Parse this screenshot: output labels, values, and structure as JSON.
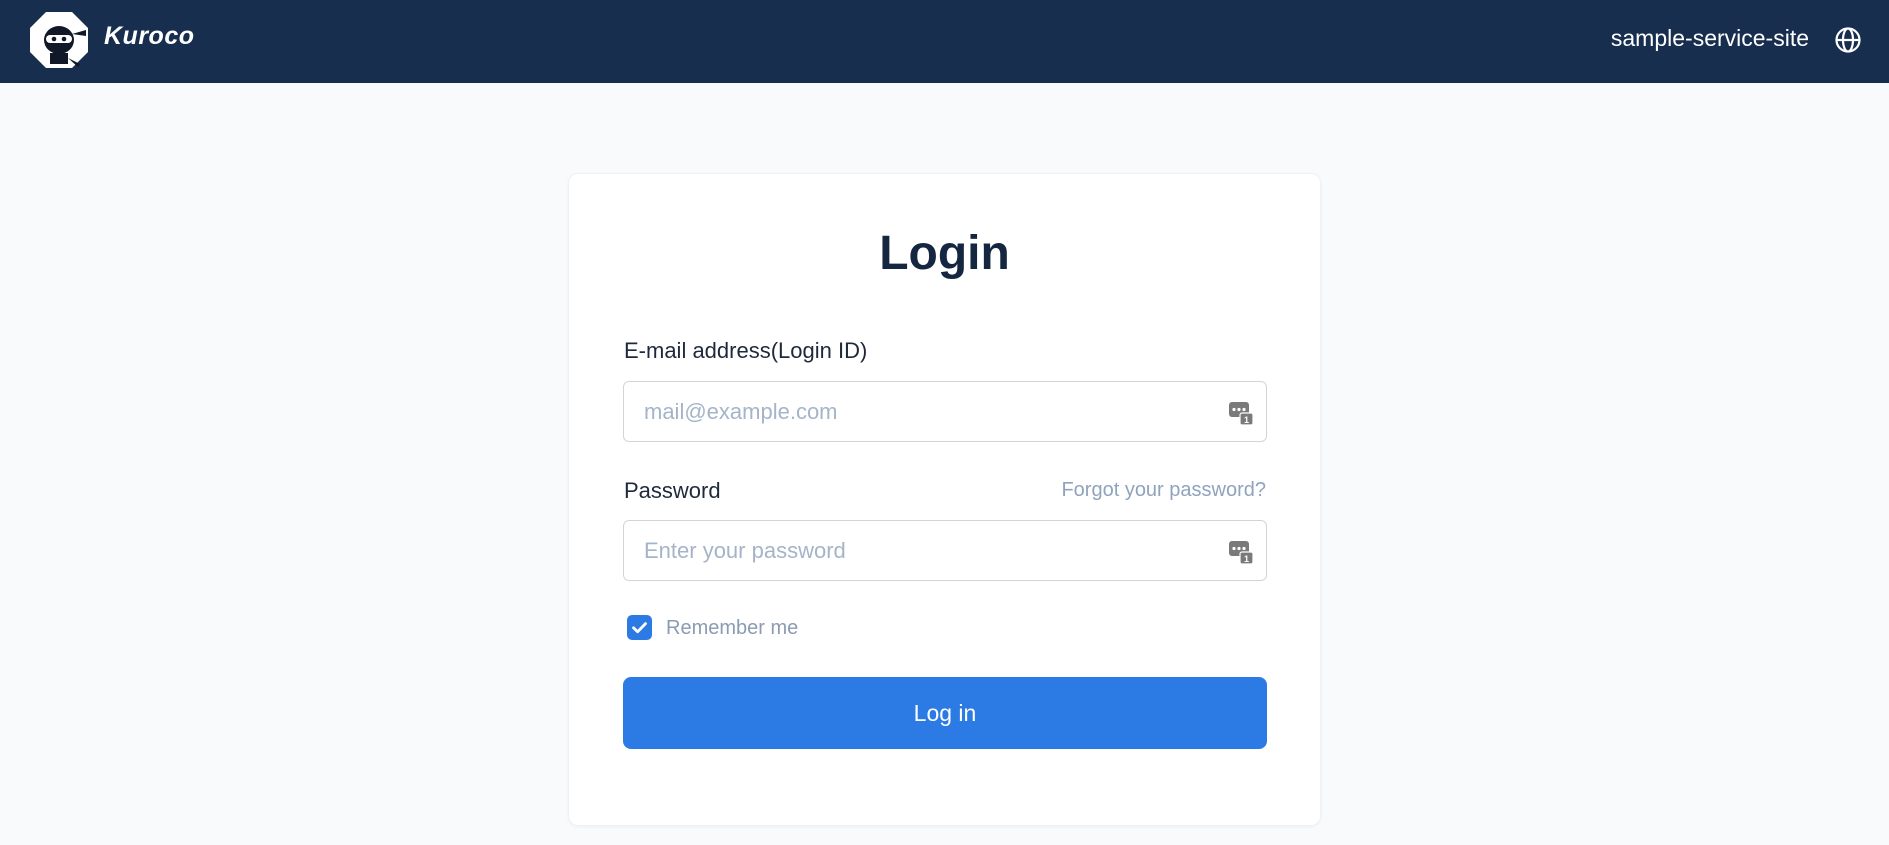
{
  "header": {
    "brand": "Kuroco",
    "site_name": "sample-service-site",
    "logo_icon": "ninja-logo-icon",
    "language_icon": "globe-icon",
    "background_color": "#172e4f"
  },
  "login": {
    "title": "Login",
    "email": {
      "label": "E-mail address(Login ID)",
      "placeholder": "mail@example.com",
      "value": ""
    },
    "password": {
      "label": "Password",
      "placeholder": "Enter your password",
      "value": "",
      "forgot_link": "Forgot your password?"
    },
    "remember_me": {
      "label": "Remember me",
      "checked": true
    },
    "submit_label": "Log in",
    "field_icon": "password-manager-icon",
    "accent_color": "#2c7be5"
  }
}
